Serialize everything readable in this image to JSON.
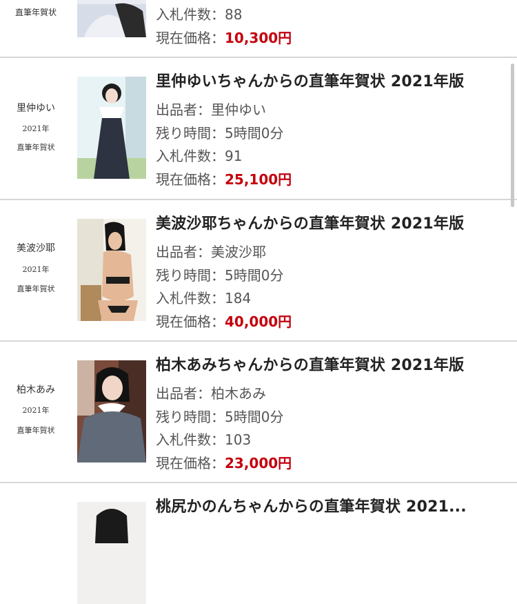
{
  "labels": {
    "seller": "出品者：",
    "time_left": "残り時間：",
    "bids": "入札件数：",
    "price": "現在価格："
  },
  "items": [
    {
      "card_name": "",
      "card_year": "",
      "card_caption": "直筆年賀状",
      "title": "",
      "seller": "",
      "time_left": "",
      "bids": "88",
      "price": "10,300円"
    },
    {
      "card_name": "里仲ゆい",
      "card_year": "2021年",
      "card_caption": "直筆年賀状",
      "title": "里仲ゆいちゃんからの直筆年賀状 2021年版",
      "seller": "里仲ゆい",
      "time_left": "5時間0分",
      "bids": "91",
      "price": "25,100円"
    },
    {
      "card_name": "美波沙耶",
      "card_year": "2021年",
      "card_caption": "直筆年賀状",
      "title": "美波沙耶ちゃんからの直筆年賀状 2021年版",
      "seller": "美波沙耶",
      "time_left": "5時間0分",
      "bids": "184",
      "price": "40,000円"
    },
    {
      "card_name": "柏木あみ",
      "card_year": "2021年",
      "card_caption": "直筆年賀状",
      "title": "柏木あみちゃんからの直筆年賀状 2021年版",
      "seller": "柏木あみ",
      "time_left": "5時間0分",
      "bids": "103",
      "price": "23,000円"
    },
    {
      "title": "桃尻かのんちゃんからの直筆年賀状 2021..."
    }
  ],
  "colors": {
    "price": "#c4000e",
    "separator": "#d6d6d6"
  }
}
